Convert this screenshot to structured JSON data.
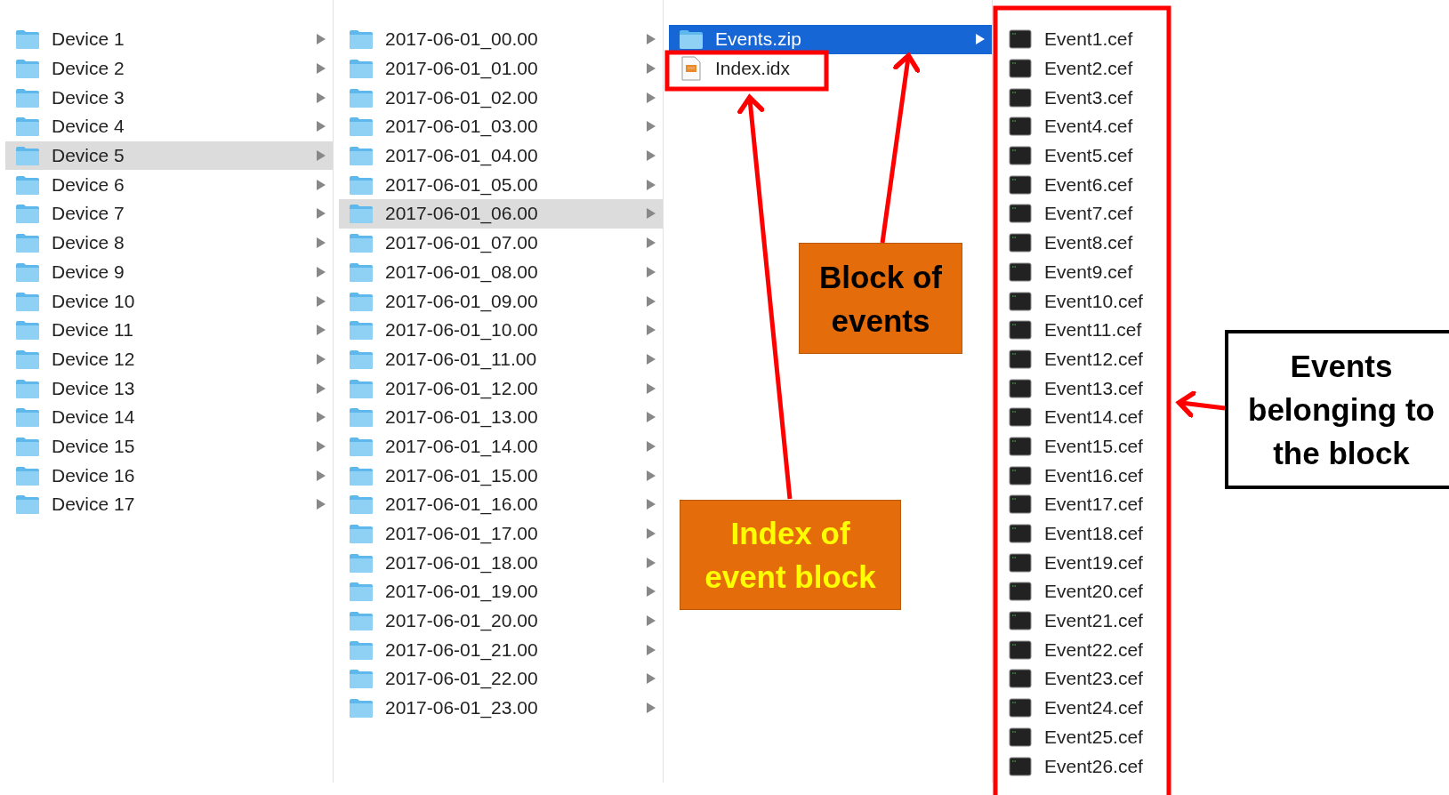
{
  "columns": [
    {
      "items": [
        {
          "kind": "folder",
          "name": "Device 1",
          "selected": false
        },
        {
          "kind": "folder",
          "name": "Device 2",
          "selected": false
        },
        {
          "kind": "folder",
          "name": "Device 3",
          "selected": false
        },
        {
          "kind": "folder",
          "name": "Device 4",
          "selected": false
        },
        {
          "kind": "folder",
          "name": "Device 5",
          "selected": true
        },
        {
          "kind": "folder",
          "name": "Device 6",
          "selected": false
        },
        {
          "kind": "folder",
          "name": "Device 7",
          "selected": false
        },
        {
          "kind": "folder",
          "name": "Device 8",
          "selected": false
        },
        {
          "kind": "folder",
          "name": "Device 9",
          "selected": false
        },
        {
          "kind": "folder",
          "name": "Device 10",
          "selected": false
        },
        {
          "kind": "folder",
          "name": "Device 11",
          "selected": false
        },
        {
          "kind": "folder",
          "name": "Device 12",
          "selected": false
        },
        {
          "kind": "folder",
          "name": "Device 13",
          "selected": false
        },
        {
          "kind": "folder",
          "name": "Device 14",
          "selected": false
        },
        {
          "kind": "folder",
          "name": "Device 15",
          "selected": false
        },
        {
          "kind": "folder",
          "name": "Device 16",
          "selected": false
        },
        {
          "kind": "folder",
          "name": "Device 17",
          "selected": false
        }
      ]
    },
    {
      "items": [
        {
          "kind": "folder",
          "name": "2017-06-01_00.00",
          "selected": false
        },
        {
          "kind": "folder",
          "name": "2017-06-01_01.00",
          "selected": false
        },
        {
          "kind": "folder",
          "name": "2017-06-01_02.00",
          "selected": false
        },
        {
          "kind": "folder",
          "name": "2017-06-01_03.00",
          "selected": false
        },
        {
          "kind": "folder",
          "name": "2017-06-01_04.00",
          "selected": false
        },
        {
          "kind": "folder",
          "name": "2017-06-01_05.00",
          "selected": false
        },
        {
          "kind": "folder",
          "name": "2017-06-01_06.00",
          "selected": true
        },
        {
          "kind": "folder",
          "name": "2017-06-01_07.00",
          "selected": false
        },
        {
          "kind": "folder",
          "name": "2017-06-01_08.00",
          "selected": false
        },
        {
          "kind": "folder",
          "name": "2017-06-01_09.00",
          "selected": false
        },
        {
          "kind": "folder",
          "name": "2017-06-01_10.00",
          "selected": false
        },
        {
          "kind": "folder",
          "name": "2017-06-01_11.00",
          "selected": false
        },
        {
          "kind": "folder",
          "name": "2017-06-01_12.00",
          "selected": false
        },
        {
          "kind": "folder",
          "name": "2017-06-01_13.00",
          "selected": false
        },
        {
          "kind": "folder",
          "name": "2017-06-01_14.00",
          "selected": false
        },
        {
          "kind": "folder",
          "name": "2017-06-01_15.00",
          "selected": false
        },
        {
          "kind": "folder",
          "name": "2017-06-01_16.00",
          "selected": false
        },
        {
          "kind": "folder",
          "name": "2017-06-01_17.00",
          "selected": false
        },
        {
          "kind": "folder",
          "name": "2017-06-01_18.00",
          "selected": false
        },
        {
          "kind": "folder",
          "name": "2017-06-01_19.00",
          "selected": false
        },
        {
          "kind": "folder",
          "name": "2017-06-01_20.00",
          "selected": false
        },
        {
          "kind": "folder",
          "name": "2017-06-01_21.00",
          "selected": false
        },
        {
          "kind": "folder",
          "name": "2017-06-01_22.00",
          "selected": false
        },
        {
          "kind": "folder",
          "name": "2017-06-01_23.00",
          "selected": false
        }
      ]
    },
    {
      "items": [
        {
          "kind": "folder",
          "name": "Events.zip",
          "selected": true
        },
        {
          "kind": "index",
          "name": "Index.idx",
          "selected": false
        }
      ]
    },
    {
      "items": [
        {
          "kind": "event",
          "name": "Event1.cef",
          "selected": false
        },
        {
          "kind": "event",
          "name": "Event2.cef",
          "selected": false
        },
        {
          "kind": "event",
          "name": "Event3.cef",
          "selected": false
        },
        {
          "kind": "event",
          "name": "Event4.cef",
          "selected": false
        },
        {
          "kind": "event",
          "name": "Event5.cef",
          "selected": false
        },
        {
          "kind": "event",
          "name": "Event6.cef",
          "selected": false
        },
        {
          "kind": "event",
          "name": "Event7.cef",
          "selected": false
        },
        {
          "kind": "event",
          "name": "Event8.cef",
          "selected": false
        },
        {
          "kind": "event",
          "name": "Event9.cef",
          "selected": false
        },
        {
          "kind": "event",
          "name": "Event10.cef",
          "selected": false
        },
        {
          "kind": "event",
          "name": "Event11.cef",
          "selected": false
        },
        {
          "kind": "event",
          "name": "Event12.cef",
          "selected": false
        },
        {
          "kind": "event",
          "name": "Event13.cef",
          "selected": false
        },
        {
          "kind": "event",
          "name": "Event14.cef",
          "selected": false
        },
        {
          "kind": "event",
          "name": "Event15.cef",
          "selected": false
        },
        {
          "kind": "event",
          "name": "Event16.cef",
          "selected": false
        },
        {
          "kind": "event",
          "name": "Event17.cef",
          "selected": false
        },
        {
          "kind": "event",
          "name": "Event18.cef",
          "selected": false
        },
        {
          "kind": "event",
          "name": "Event19.cef",
          "selected": false
        },
        {
          "kind": "event",
          "name": "Event20.cef",
          "selected": false
        },
        {
          "kind": "event",
          "name": "Event21.cef",
          "selected": false
        },
        {
          "kind": "event",
          "name": "Event22.cef",
          "selected": false
        },
        {
          "kind": "event",
          "name": "Event23.cef",
          "selected": false
        },
        {
          "kind": "event",
          "name": "Event24.cef",
          "selected": false
        },
        {
          "kind": "event",
          "name": "Event25.cef",
          "selected": false
        },
        {
          "kind": "event",
          "name": "Event26.cef",
          "selected": false
        }
      ]
    }
  ],
  "annotations": [
    {
      "kind": "filled",
      "text": "Block of events",
      "color": "#000000"
    },
    {
      "kind": "filled",
      "text": "Index of event block",
      "color": "#ffff00"
    },
    {
      "kind": "outlined",
      "text": "Events belonging to the block",
      "color": "#000000"
    }
  ]
}
